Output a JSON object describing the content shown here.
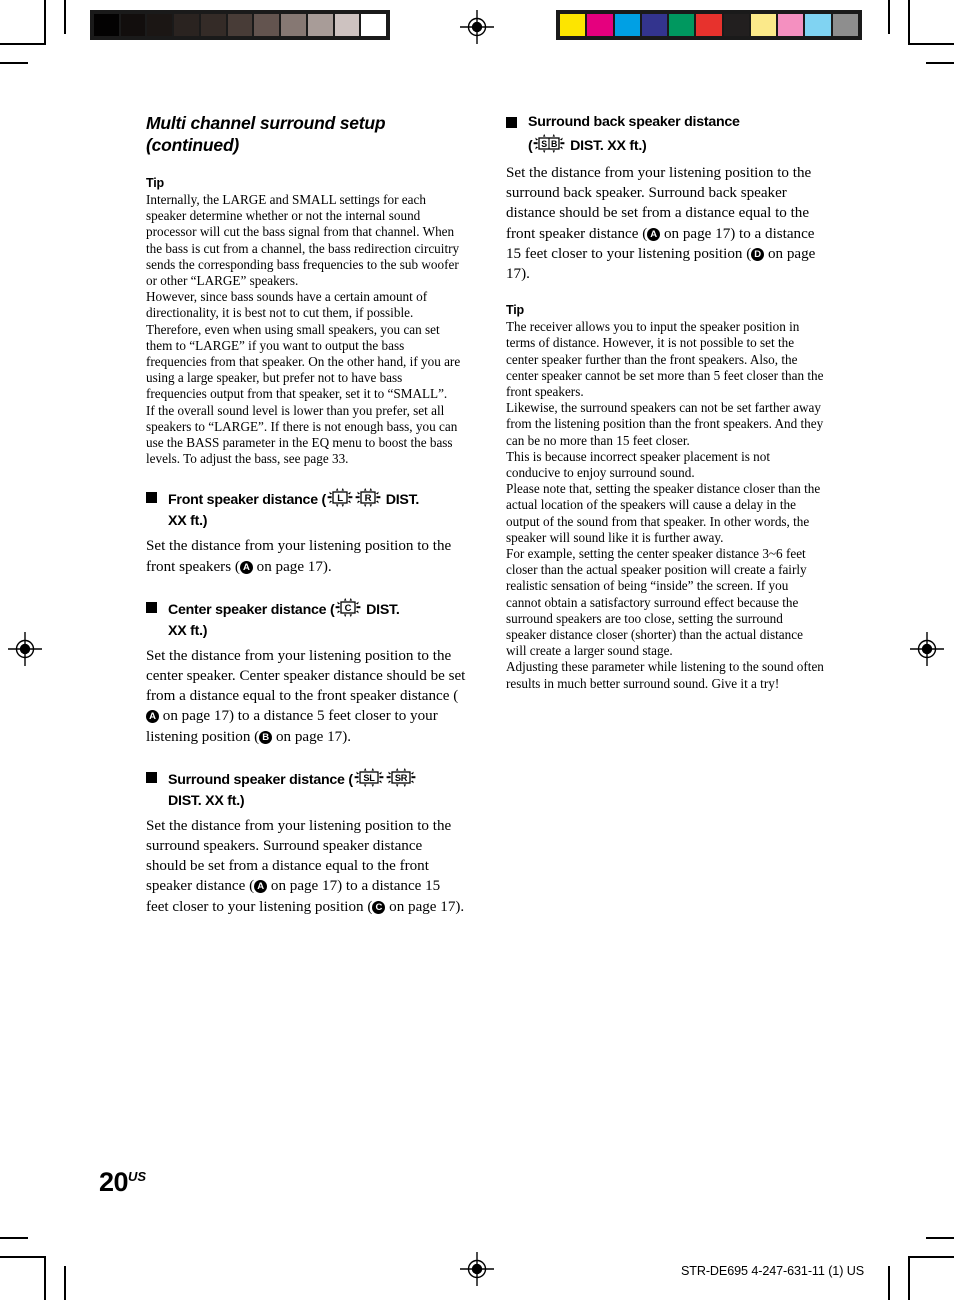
{
  "page": {
    "folio_number": "20",
    "folio_suffix": "US",
    "model_line": "STR-DE695 4-247-631-11 (1) US"
  },
  "calibration": {
    "grayscale_label": "grayscale-calibration-strip",
    "grayscale_patches": [
      "#030202",
      "#120e0d",
      "#1b1614",
      "#2a2320",
      "#342b27",
      "#483c37",
      "#63544f",
      "#867873",
      "#a89c98",
      "#cdc2c0",
      "#ffffff"
    ],
    "color_label": "color-calibration-strip",
    "color_patches": [
      "#fde500",
      "#e5007e",
      "#00a0e4",
      "#33348e",
      "#00985f",
      "#e7322d",
      "#221f1f",
      "#fbe98a",
      "#f490c0",
      "#80d3f2",
      "#8e8e8e"
    ]
  },
  "left_column": {
    "title_line1": "Multi channel surround setup",
    "title_line2": "(continued)",
    "tip_heading": "Tip",
    "tip_paragraphs": [
      "Internally, the LARGE and SMALL settings for each speaker determine whether or not the internal sound processor will cut the bass signal from that channel. When the bass is cut from a channel, the bass redirection circuitry sends the corresponding bass frequencies to the sub woofer or other “LARGE” speakers.",
      "However, since bass sounds have a certain amount of directionality, it is best not to cut them, if possible. Therefore, even when using small speakers, you can set them to “LARGE” if you want to output the bass frequencies from that speaker. On the other hand, if you are using a large speaker, but prefer not to have bass frequencies output from that speaker, set it to “SMALL”.",
      "If the overall sound level is lower than you prefer, set all speakers to “LARGE”. If there is not enough bass, you can use the BASS parameter in the EQ menu to boost the bass levels. To adjust the bass, see page 33."
    ],
    "sections": [
      {
        "head_prefix": "Front speaker distance (",
        "icons": [
          "L",
          "R"
        ],
        "head_middle": " DIST.",
        "head_line2": "XX ft.)",
        "body_parts": {
          "p1a": "Set the distance from your listening position to the front speakers (",
          "callout1": "A",
          "p1b": " on page 17)."
        }
      },
      {
        "head_prefix": "Center speaker distance (",
        "icons": [
          "C"
        ],
        "head_middle": " DIST.",
        "head_line2": "XX ft.)",
        "body_parts": {
          "p1a": "Set the distance from your listening position to the center speaker. Center speaker distance should be set from a distance equal to the front speaker distance (",
          "callout1": "A",
          "p1b": " on page 17) to a distance 5 feet closer to your listening position (",
          "callout2": "B",
          "p1c": " on page 17)."
        }
      },
      {
        "head_prefix": "Surround speaker distance (",
        "icons": [
          "SL",
          "SR"
        ],
        "head_middle": "",
        "head_line2": "DIST. XX ft.)",
        "body_parts": {
          "p1a": "Set the distance from your listening position to the surround speakers. Surround speaker distance should be set from a distance equal to the front speaker distance (",
          "callout1": "A",
          "p1b": " on page 17) to a distance 15 feet closer to your listening position (",
          "callout2": "C",
          "p1c": " on page 17)."
        }
      }
    ]
  },
  "right_column": {
    "section": {
      "head_line1": "Surround back speaker distance",
      "head_line2_prefix": "(",
      "icon": "S B",
      "head_line2_suffix": " DIST. XX ft.)",
      "body_parts": {
        "p1a": "Set the distance from your listening position to the surround back speaker. Surround back speaker distance should be set from a distance equal to the front speaker distance (",
        "callout1": "A",
        "p1b": " on page 17) to a distance 15 feet closer to your listening position (",
        "callout2": "D",
        "p1c": " on page 17)."
      }
    },
    "tip_heading": "Tip",
    "tip_paragraphs": [
      "The receiver allows you to input the speaker position in terms of distance. However, it is not possible to set the center speaker further than the front speakers. Also, the center speaker cannot be set more than 5 feet closer than the front speakers.",
      "Likewise, the surround speakers can not be set farther away from the listening position than the front speakers. And they can be no more than 15 feet closer.",
      "This is because incorrect speaker placement is not conducive to enjoy surround sound.",
      "Please note that, setting the speaker distance closer than the actual location of the speakers will cause a delay in the output of the sound from that speaker. In other words, the speaker will sound like it is further away.",
      "For example, setting the center speaker distance 3~6 feet closer than the actual speaker position will create a fairly realistic sensation of being “inside” the screen. If you cannot obtain a satisfactory surround effect because the surround speakers are too close, setting the surround speaker distance closer (shorter) than the actual distance will create a larger sound stage.",
      "Adjusting these parameter while listening to the sound often results in much better surround sound. Give it a try!"
    ]
  }
}
